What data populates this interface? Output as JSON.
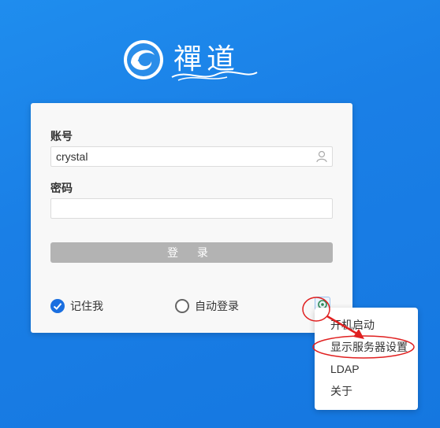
{
  "brand": {
    "logo_text": "禪道",
    "logo_icon": "zentao-logo-icon"
  },
  "login_form": {
    "username_label": "账号",
    "username_value": "crystal",
    "username_icon": "user-icon",
    "password_label": "密码",
    "password_value": "",
    "login_button": "登 录",
    "remember_me_label": "记住我",
    "remember_me_checked": true,
    "auto_login_label": "自动登录",
    "auto_login_checked": false,
    "settings_icon": "settings-icon"
  },
  "context_menu": {
    "items": [
      {
        "label": "开机启动"
      },
      {
        "label": "显示服务器设置"
      },
      {
        "label": "LDAP"
      },
      {
        "label": "关于"
      }
    ]
  },
  "colors": {
    "background": "#1a7fe6",
    "accent": "#1a6fe0",
    "login_button_disabled": "#b3b3b3",
    "annotation_red": "#e02020"
  }
}
